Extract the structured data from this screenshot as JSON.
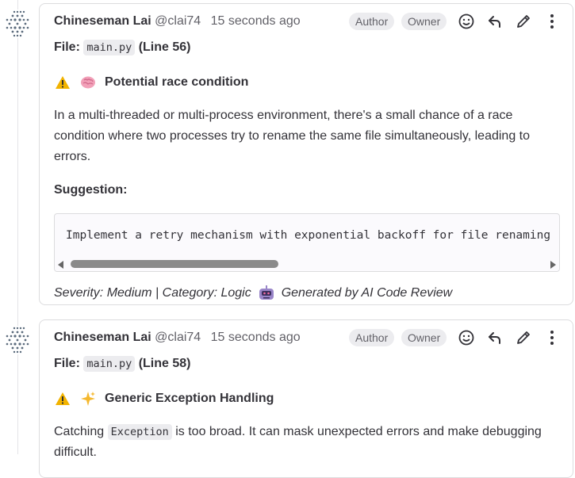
{
  "notes": [
    {
      "author_name": "Chineseman Lai",
      "author_handle": "@clai74",
      "time": "15 seconds ago",
      "badges": [
        "Author",
        "Owner"
      ],
      "file_label": "File:",
      "file_name": "main.py",
      "line_ref": "(Line 56)",
      "title": "Potential race condition",
      "title_emoji": "brain-icon",
      "paragraph": "In a multi-threaded or multi-process environment, there's a small chance of a race condition where two processes try to rename the same file simultaneously, leading to errors.",
      "suggestion_label": "Suggestion:",
      "suggestion_code": "Implement a retry mechanism with exponential backoff for file renaming",
      "footer_left": "Severity: Medium | Category: Logic",
      "footer_right": "Generated by AI Code Review"
    },
    {
      "author_name": "Chineseman Lai",
      "author_handle": "@clai74",
      "time": "15 seconds ago",
      "badges": [
        "Author",
        "Owner"
      ],
      "file_label": "File:",
      "file_name": "main.py",
      "line_ref": "(Line 58)",
      "title": "Generic Exception Handling",
      "title_emoji": "sparkles-icon",
      "para_code": "Exception",
      "para_pre": "Catching",
      "para_post": "is too broad. It can mask unexpected errors and make debugging difficult."
    }
  ],
  "colors": {
    "badge_bg": "#ececef",
    "border": "#dcdcde",
    "text": "#333238",
    "muted": "#626168"
  }
}
